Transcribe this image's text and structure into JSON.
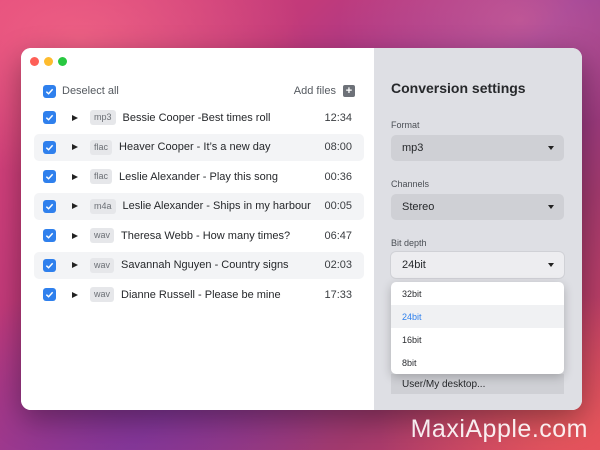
{
  "header": {
    "deselect_label": "Deselect all",
    "add_files_label": "Add files",
    "add_icon": "+"
  },
  "files": [
    {
      "format": "mp3",
      "title": "Bessie Cooper -Best times roll",
      "duration": "12:34",
      "checked": true
    },
    {
      "format": "flac",
      "title": "Heaver Cooper - It’s a new day",
      "duration": "08:00",
      "checked": true
    },
    {
      "format": "flac",
      "title": "Leslie Alexander - Play this song",
      "duration": "00:36",
      "checked": true
    },
    {
      "format": "m4a",
      "title": "Leslie Alexander  - Ships in my harbour",
      "duration": "00:05",
      "checked": true
    },
    {
      "format": "wav",
      "title": "Theresa Webb - How many times?",
      "duration": "06:47",
      "checked": true
    },
    {
      "format": "wav",
      "title": "Savannah Nguyen - Country signs",
      "duration": "02:03",
      "checked": true
    },
    {
      "format": "wav",
      "title": "Dianne Russell - Please be mine",
      "duration": "17:33",
      "checked": true
    }
  ],
  "settings": {
    "title": "Conversion settings",
    "format_label": "Format",
    "format_value": "mp3",
    "channels_label": "Channels",
    "channels_value": "Stereo",
    "bitdepth_label": "Bit depth",
    "bitdepth_value": "24bit",
    "bitdepth_options": [
      "32bit",
      "24bit",
      "16bit",
      "8bit"
    ],
    "bitdepth_selected": "24bit",
    "destination_value": "User/My desktop..."
  },
  "watermark": "MaxiApple.com",
  "colors": {
    "accent": "#2f80ed",
    "close": "#fe5f57",
    "minimize": "#febc2e",
    "zoom": "#28c840"
  }
}
